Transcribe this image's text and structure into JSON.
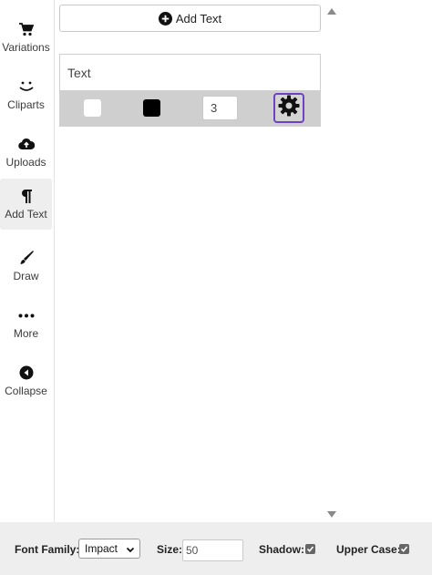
{
  "sidebar": {
    "items": [
      {
        "label": "Variations",
        "icon": "cart-icon",
        "active": false
      },
      {
        "label": "Cliparts",
        "icon": "smile-icon",
        "active": false
      },
      {
        "label": "Uploads",
        "icon": "cloud-upload-icon",
        "active": false
      },
      {
        "label": "Add Text",
        "icon": "paragraph-icon",
        "active": true
      },
      {
        "label": "Draw",
        "icon": "brush-icon",
        "active": false
      },
      {
        "label": "More",
        "icon": "ellipsis-icon",
        "active": false
      },
      {
        "label": "Collapse",
        "icon": "collapse-left-icon",
        "active": false
      }
    ]
  },
  "main": {
    "add_text_label": "Add Text",
    "text_item": {
      "placeholder": "Text",
      "fill_color": "#ffffff",
      "stroke_color": "#000000",
      "stroke_width": "3"
    }
  },
  "toolbar": {
    "font_family_label": "Font Family:",
    "font_family_value": "Impact",
    "size_label": "Size:",
    "size_value": "50",
    "shadow_label": "Shadow:",
    "shadow_checked": true,
    "uppercase_label": "Upper Case:",
    "uppercase_checked": true
  },
  "colors": {
    "accent": "#6f42c1",
    "active_bg": "#eeeeee"
  }
}
